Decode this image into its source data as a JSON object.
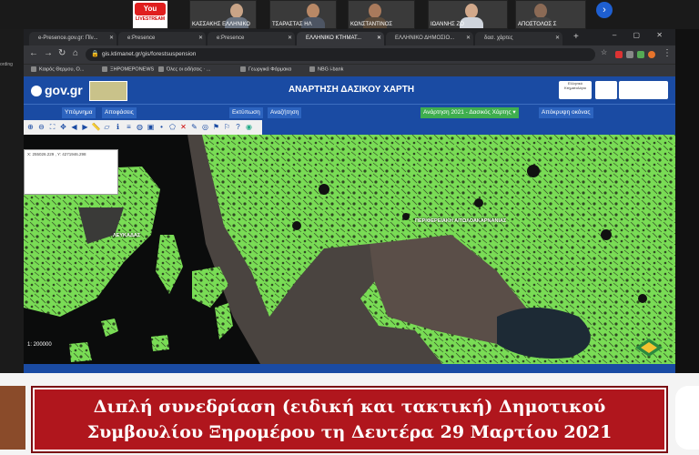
{
  "video_strip": {
    "youtube_label": "You Tube",
    "youtube_sub": "LIVESTREAM",
    "participants": [
      {
        "name": "ΚΑΣΣΑΚΗΣ ΕΛΛΗΝΙΚΟ"
      },
      {
        "name": "ΤΣΑΡΑΣΤΑΣ ΗΛ"
      },
      {
        "name": "ΚΩΝΣΤΑΝΤΙΝΟΣ"
      },
      {
        "name": "ΙΩΑΝΝΗΣ ΖΟ"
      },
      {
        "name": "ΑΠΟΣΤΟΛΟΣ Σ"
      }
    ],
    "next_arrow": "›"
  },
  "side_label": "ording",
  "browser": {
    "tabs": [
      {
        "label": "e-Presence.gov.gr: Πίν...",
        "active": false
      },
      {
        "label": "e:Presence",
        "active": false
      },
      {
        "label": "e:Presence",
        "active": false
      },
      {
        "label": "ΕΛΛΗΝΙΚΟ ΚΤΗΜΑΤ...",
        "active": true
      },
      {
        "label": "ΕΛΛΗΝΙΚΟ ΔΗΜΟΣΙΟ...",
        "active": false
      },
      {
        "label": "δασ. χάρτες",
        "active": false
      }
    ],
    "new_tab": "+",
    "window_controls": "– ▢ ✕",
    "url": "gis.ktimanet.gr/gis/forestsuspension",
    "bookmarks": [
      "Καιρός Θερμου, Ο...",
      "ΞΗΡΟΜΕΡΟNEWS",
      "Όλες οι ειδήσεις · ...",
      "Γεωργικά Φάρμακα",
      "NBG i-bank"
    ]
  },
  "site": {
    "logo": "gov.gr",
    "heading": "ΑΝΑΡΤΗΣΗ ΔΑΣΙΚΟΥ ΧΑΡΤΗ",
    "header_logo_text": "Ελληνικό Κτηματολόγιο",
    "menu": [
      {
        "label": "Υπόμνημα",
        "style": "blue"
      },
      {
        "label": "Αποφάσεις",
        "style": "blue"
      },
      {
        "label": "Εκτύπωση",
        "style": "blue"
      },
      {
        "label": "Αναζήτηση",
        "style": "blue"
      },
      {
        "label": "Ανάρτηση 2021 - Δασικός Χάρτης ▾",
        "style": "green"
      },
      {
        "label": "Απόκρυψη οκόνας",
        "style": "blue"
      }
    ]
  },
  "map": {
    "coordinates": "X: 255026.229 , Y: 4271946.298",
    "scale": "1: 200000",
    "places": [
      "ΛΕΥΚΑΔΑΣ",
      "ΠΕΡΙΦΕΡΕΙΑΚΗ ΑΙΤΩΛΟΑΚΑΡΝΑΝΙΑΣ"
    ]
  },
  "caption": {
    "line1": "Διπλή συνεδρίαση (ειδική και τακτική) Δημοτικού",
    "line2": "Συμβουλίου Ξηρομέρου τη Δευτέρα 29 Μαρτίου 2021"
  },
  "colors": {
    "accent": "#1a4ba3",
    "forest": "#7de25a",
    "caption_red": "#b0161d"
  }
}
